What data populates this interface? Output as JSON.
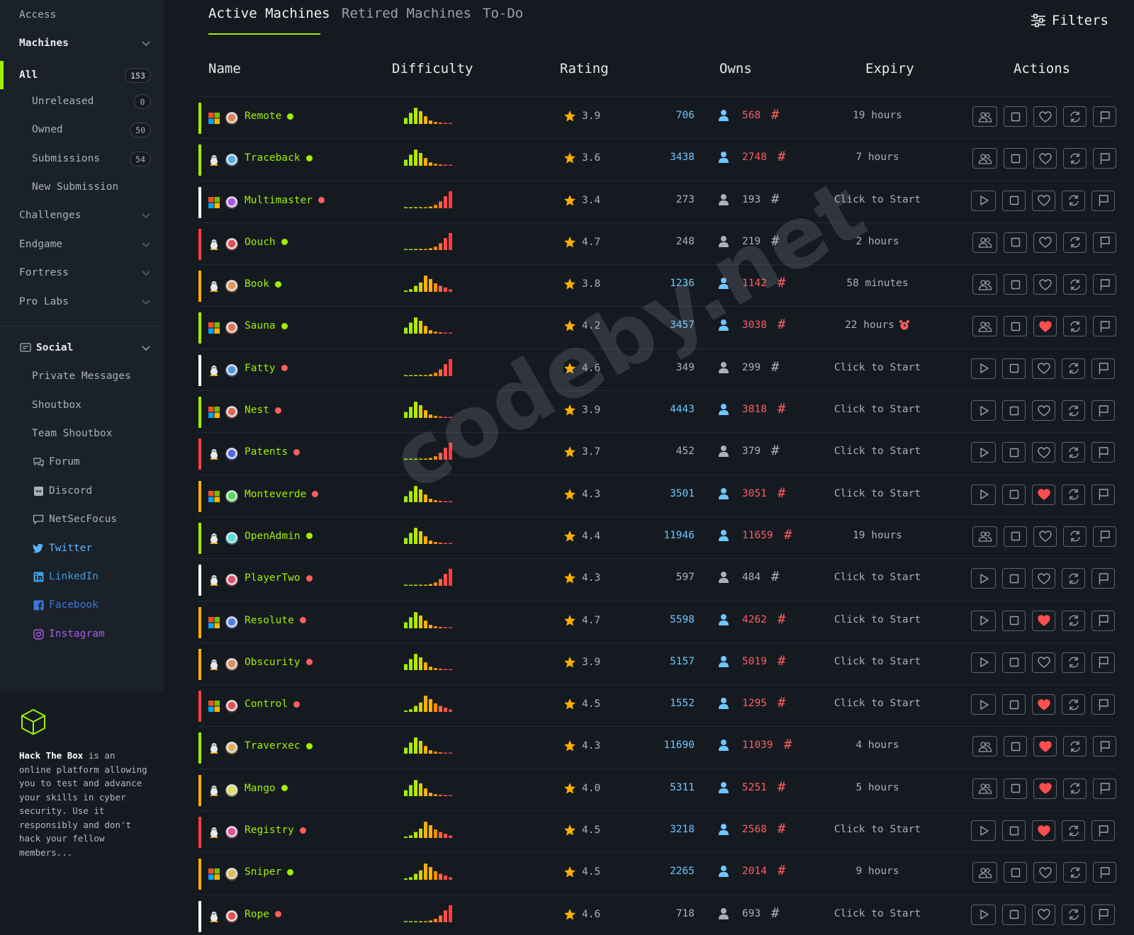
{
  "sidebar": {
    "access": "Access",
    "machines": "Machines",
    "all": {
      "label": "All",
      "count": "153"
    },
    "unreleased": {
      "label": "Unreleased",
      "count": "0"
    },
    "owned": {
      "label": "Owned",
      "count": "50"
    },
    "submissions": {
      "label": "Submissions",
      "count": "54"
    },
    "new_submission": "New Submission",
    "challenges": "Challenges",
    "endgame": "Endgame",
    "fortress": "Fortress",
    "pro_labs": "Pro Labs",
    "social": "Social",
    "private_messages": "Private Messages",
    "shoutbox": "Shoutbox",
    "team_shoutbox": "Team Shoutbox",
    "forum": "Forum",
    "discord": "Discord",
    "netsecfocus": "NetSecFocus",
    "twitter": "Twitter",
    "linkedin": "LinkedIn",
    "facebook": "Facebook",
    "instagram": "Instagram",
    "footer_brand": "Hack The Box",
    "footer_text": " is an online platform allowing you to test and advance your skills in cyber security. Use it responsibly and don't hack your fellow members..."
  },
  "tabs": [
    "Active Machines",
    "Retired Machines",
    "To-Do"
  ],
  "filters_label": "Filters",
  "columns": [
    "Name",
    "Difficulty",
    "Rating",
    "Owns",
    "Expiry",
    "Actions"
  ],
  "watermark": "codeby.net",
  "colors": {
    "easy": "#9fef00",
    "medium": "#ffaf00",
    "hard": "#ff3e3e",
    "insane": "#ffffff",
    "blue": "#6cc6ff",
    "red": "#ff5e5e",
    "star": "#ffaf00"
  },
  "machines": [
    {
      "name": "Remote",
      "os": "windows",
      "tier": "easy",
      "status": "easy",
      "diff": "easy",
      "rating": "3.9",
      "users": "706",
      "roots": "568",
      "owned": true,
      "expiry": "19 hours",
      "active": true,
      "fav": false,
      "alarm": false
    },
    {
      "name": "Traceback",
      "os": "linux",
      "tier": "easy",
      "status": "easy",
      "diff": "easy",
      "rating": "3.6",
      "users": "3438",
      "roots": "2748",
      "owned": true,
      "expiry": "7 hours",
      "active": true,
      "fav": false,
      "alarm": false
    },
    {
      "name": "Multimaster",
      "os": "windows",
      "tier": "insane",
      "status": "hard",
      "diff": "insane",
      "rating": "3.4",
      "users": "273",
      "roots": "193",
      "owned": false,
      "expiry": "Click to Start",
      "active": false,
      "fav": false,
      "alarm": false
    },
    {
      "name": "Oouch",
      "os": "linux",
      "tier": "hard",
      "status": "easy",
      "diff": "insane",
      "rating": "4.7",
      "users": "248",
      "roots": "219",
      "owned": false,
      "expiry": "2 hours",
      "active": true,
      "fav": false,
      "alarm": false
    },
    {
      "name": "Book",
      "os": "linux",
      "tier": "medium",
      "status": "easy",
      "diff": "medium",
      "rating": "3.8",
      "users": "1236",
      "roots": "1142",
      "owned": true,
      "expiry": "58 minutes",
      "active": true,
      "fav": false,
      "alarm": false
    },
    {
      "name": "Sauna",
      "os": "windows",
      "tier": "easy",
      "status": "easy",
      "diff": "easy",
      "rating": "4.2",
      "users": "3457",
      "roots": "3038",
      "owned": true,
      "expiry": "22 hours",
      "active": true,
      "fav": true,
      "alarm": true
    },
    {
      "name": "Fatty",
      "os": "linux",
      "tier": "insane",
      "status": "hard",
      "diff": "insane",
      "rating": "4.6",
      "users": "349",
      "roots": "299",
      "owned": false,
      "expiry": "Click to Start",
      "active": false,
      "fav": false,
      "alarm": false
    },
    {
      "name": "Nest",
      "os": "windows",
      "tier": "easy",
      "status": "hard",
      "diff": "easy",
      "rating": "3.9",
      "users": "4443",
      "roots": "3818",
      "owned": true,
      "expiry": "Click to Start",
      "active": false,
      "fav": false,
      "alarm": false
    },
    {
      "name": "Patents",
      "os": "linux",
      "tier": "hard",
      "status": "hard",
      "diff": "insane",
      "rating": "3.7",
      "users": "452",
      "roots": "379",
      "owned": false,
      "expiry": "Click to Start",
      "active": false,
      "fav": false,
      "alarm": false
    },
    {
      "name": "Monteverde",
      "os": "windows",
      "tier": "medium",
      "status": "hard",
      "diff": "easy",
      "rating": "4.3",
      "users": "3501",
      "roots": "3051",
      "owned": true,
      "expiry": "Click to Start",
      "active": false,
      "fav": true,
      "alarm": false
    },
    {
      "name": "OpenAdmin",
      "os": "linux",
      "tier": "easy",
      "status": "easy",
      "diff": "easy",
      "rating": "4.4",
      "users": "11946",
      "roots": "11659",
      "owned": true,
      "expiry": "19 hours",
      "active": true,
      "fav": false,
      "alarm": false
    },
    {
      "name": "PlayerTwo",
      "os": "linux",
      "tier": "insane",
      "status": "hard",
      "diff": "insane",
      "rating": "4.3",
      "users": "597",
      "roots": "484",
      "owned": false,
      "expiry": "Click to Start",
      "active": false,
      "fav": false,
      "alarm": false
    },
    {
      "name": "Resolute",
      "os": "windows",
      "tier": "medium",
      "status": "hard",
      "diff": "easy",
      "rating": "4.7",
      "users": "5598",
      "roots": "4262",
      "owned": true,
      "expiry": "Click to Start",
      "active": false,
      "fav": true,
      "alarm": false
    },
    {
      "name": "Obscurity",
      "os": "linux",
      "tier": "medium",
      "status": "hard",
      "diff": "easy",
      "rating": "3.9",
      "users": "5157",
      "roots": "5019",
      "owned": true,
      "expiry": "Click to Start",
      "active": false,
      "fav": false,
      "alarm": false
    },
    {
      "name": "Control",
      "os": "windows",
      "tier": "hard",
      "status": "hard",
      "diff": "medium",
      "rating": "4.5",
      "users": "1552",
      "roots": "1295",
      "owned": true,
      "expiry": "Click to Start",
      "active": false,
      "fav": true,
      "alarm": false
    },
    {
      "name": "Traverxec",
      "os": "linux",
      "tier": "easy",
      "status": "easy",
      "diff": "easy",
      "rating": "4.3",
      "users": "11690",
      "roots": "11039",
      "owned": true,
      "expiry": "4 hours",
      "active": true,
      "fav": true,
      "alarm": false
    },
    {
      "name": "Mango",
      "os": "linux",
      "tier": "medium",
      "status": "easy",
      "diff": "easy",
      "rating": "4.0",
      "users": "5311",
      "roots": "5251",
      "owned": true,
      "expiry": "5 hours",
      "active": true,
      "fav": true,
      "alarm": false
    },
    {
      "name": "Registry",
      "os": "linux",
      "tier": "hard",
      "status": "hard",
      "diff": "medium",
      "rating": "4.5",
      "users": "3218",
      "roots": "2568",
      "owned": true,
      "expiry": "Click to Start",
      "active": false,
      "fav": true,
      "alarm": false
    },
    {
      "name": "Sniper",
      "os": "windows",
      "tier": "medium",
      "status": "easy",
      "diff": "medium",
      "rating": "4.5",
      "users": "2265",
      "roots": "2014",
      "owned": true,
      "expiry": "9 hours",
      "active": true,
      "fav": false,
      "alarm": false
    },
    {
      "name": "Rope",
      "os": "linux",
      "tier": "insane",
      "status": "hard",
      "diff": "insane",
      "rating": "4.6",
      "users": "718",
      "roots": "693",
      "owned": false,
      "expiry": "Click to Start",
      "active": false,
      "fav": false,
      "alarm": false
    }
  ]
}
